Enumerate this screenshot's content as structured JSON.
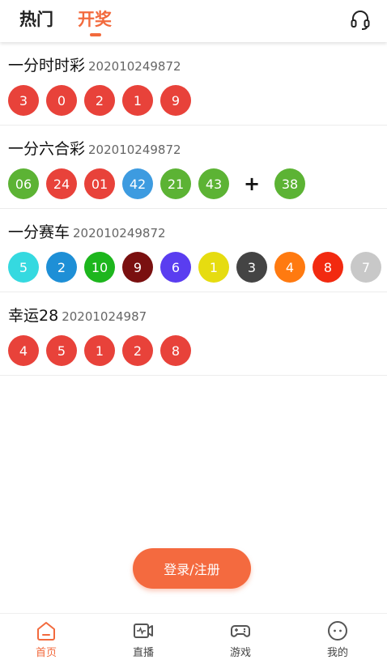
{
  "header": {
    "tabs": [
      {
        "label": "热门"
      },
      {
        "label": "开奖"
      }
    ],
    "active_tab": "开奖"
  },
  "sections": [
    {
      "name": "一分时时彩",
      "issue": "202010249872",
      "balls": [
        {
          "n": "3",
          "color": "#e8423a"
        },
        {
          "n": "0",
          "color": "#e8423a"
        },
        {
          "n": "2",
          "color": "#e8423a"
        },
        {
          "n": "1",
          "color": "#e8423a"
        },
        {
          "n": "9",
          "color": "#e8423a"
        }
      ]
    },
    {
      "name": "一分六合彩",
      "issue": "202010249872",
      "balls": [
        {
          "n": "06",
          "color": "#5cb334"
        },
        {
          "n": "24",
          "color": "#e8423a"
        },
        {
          "n": "01",
          "color": "#e8423a"
        },
        {
          "n": "42",
          "color": "#3d9be0"
        },
        {
          "n": "21",
          "color": "#5cb334"
        },
        {
          "n": "43",
          "color": "#5cb334"
        }
      ],
      "special_separator": "+",
      "special": [
        {
          "n": "38",
          "color": "#5cb334"
        }
      ]
    },
    {
      "name": "一分赛车",
      "issue": "202010249872",
      "balls": [
        {
          "n": "5",
          "color": "#35d9e0"
        },
        {
          "n": "2",
          "color": "#1e8fd6"
        },
        {
          "n": "10",
          "color": "#1db61d"
        },
        {
          "n": "9",
          "color": "#7a1010"
        },
        {
          "n": "6",
          "color": "#5a3df0"
        },
        {
          "n": "1",
          "color": "#e6dc10"
        },
        {
          "n": "3",
          "color": "#444444"
        },
        {
          "n": "4",
          "color": "#ff7a10"
        },
        {
          "n": "8",
          "color": "#f22a10"
        },
        {
          "n": "7",
          "color": "#c8c8c8"
        }
      ]
    },
    {
      "name": "幸运28",
      "issue": "20201024987",
      "balls": [
        {
          "n": "4",
          "color": "#e8423a"
        },
        {
          "n": "5",
          "color": "#e8423a"
        },
        {
          "n": "1",
          "color": "#e8423a"
        },
        {
          "n": "2",
          "color": "#e8423a"
        },
        {
          "n": "8",
          "color": "#e8423a"
        }
      ]
    }
  ],
  "login_button": {
    "label": "登录/注册"
  },
  "bottom_nav": [
    {
      "label": "首页",
      "icon": "home-icon",
      "active": true
    },
    {
      "label": "直播",
      "icon": "live-video-icon",
      "active": false
    },
    {
      "label": "游戏",
      "icon": "gamepad-icon",
      "active": false
    },
    {
      "label": "我的",
      "icon": "profile-icon",
      "active": false
    }
  ],
  "colors": {
    "accent": "#f26a3d",
    "inactive": "#555555"
  }
}
